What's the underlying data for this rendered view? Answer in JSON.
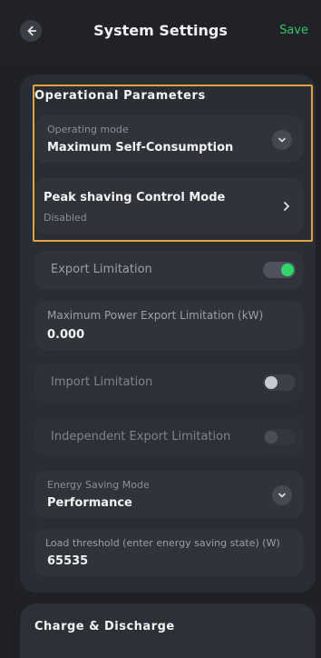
{
  "header": {
    "title": "System Settings",
    "save_label": "Save"
  },
  "operational": {
    "section_title": "Operational Parameters",
    "operating_mode": {
      "label": "Operating mode",
      "value": "Maximum Self-Consumption"
    },
    "peak_shaving": {
      "label": "Peak shaving Control Mode",
      "status": "Disabled"
    },
    "export_limitation": {
      "label": "Export Limitation",
      "enabled": true
    },
    "max_power_export": {
      "label": "Maximum Power Export Limitation (kW)",
      "value": "0.000"
    },
    "import_limitation": {
      "label": "Import Limitation",
      "enabled": false
    },
    "independent_export": {
      "label": "Independent Export Limitation",
      "enabled": false
    },
    "energy_saving": {
      "label": "Energy Saving Mode",
      "value": "Performance"
    },
    "load_threshold": {
      "label": "Load threshold (enter energy saving state) (W)",
      "value": "65535"
    }
  },
  "charge_discharge": {
    "section_title": "Charge & Discharge"
  },
  "colors": {
    "accent_green": "#2fd66a",
    "highlight_orange": "#e3a23f"
  }
}
